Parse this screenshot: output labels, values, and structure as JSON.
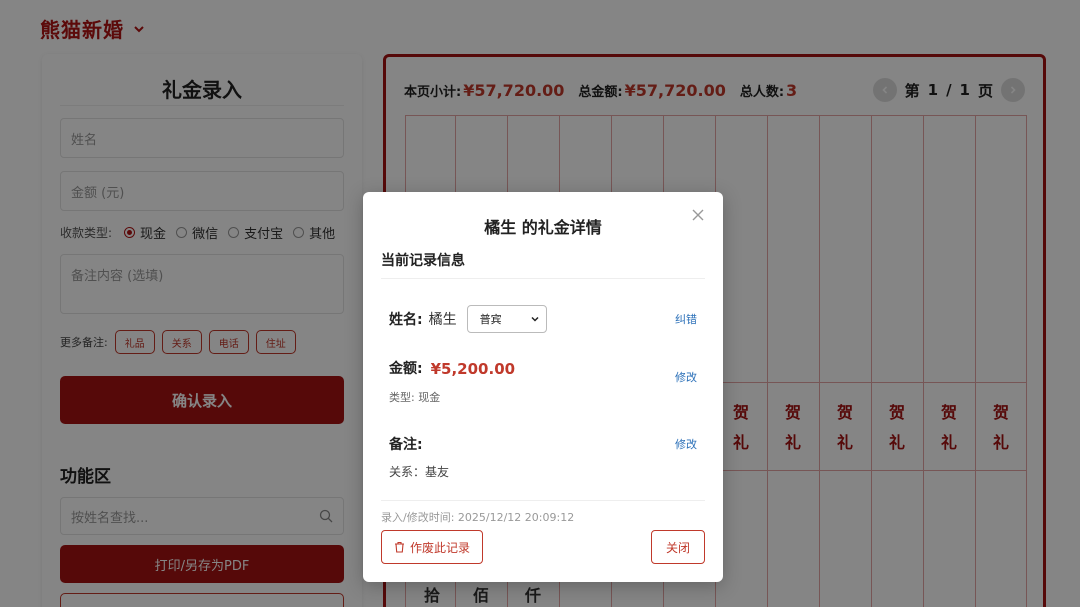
{
  "header": {
    "brand": "熊猫新婚"
  },
  "entry_form": {
    "title": "礼金录入",
    "name_placeholder": "姓名",
    "amount_placeholder": "金额 (元)",
    "payment_label": "收款类型:",
    "payment_options": [
      "现金",
      "微信",
      "支付宝",
      "其他"
    ],
    "payment_selected": "现金",
    "note_placeholder": "备注内容 (选填)",
    "more_notes_label": "更多备注:",
    "note_tags": [
      "礼品",
      "关系",
      "电话",
      "住址"
    ],
    "confirm_label": "确认录入"
  },
  "functions": {
    "title": "功能区",
    "search_placeholder": "按姓名查找...",
    "print_label": "打印/另存为PDF"
  },
  "ledger": {
    "page_subtotal_label": "本页小计:",
    "page_subtotal": "¥57,720.00",
    "total_label": "总金额:",
    "total": "¥57,720.00",
    "people_label": "总人数:",
    "people": "3",
    "page_prefix": "第",
    "page_current": "1",
    "page_sep": "/",
    "page_total": "1",
    "page_suffix": "页",
    "gift_char_top": "贺",
    "gift_char_bottom": "礼",
    "amount_chars": [
      "拾",
      "佰",
      "仟"
    ]
  },
  "modal": {
    "title": "橘生 的礼金详情",
    "section_title": "当前记录信息",
    "name_label": "姓名:",
    "name_value": "橘生",
    "guest_type_selected": "普宾",
    "correct_link": "纠错",
    "amount_label": "金额:",
    "amount_value": "¥5,200.00",
    "type_text": "类型: 现金",
    "edit_amount_link": "修改",
    "note_label": "备注:",
    "edit_note_link": "修改",
    "note_value": "关系：基友",
    "timestamp": "录入/修改时间: 2025/12/12 20:09:12",
    "void_label": "作废此记录",
    "close_label": "关闭"
  },
  "colors": {
    "brand_red": "#a51212",
    "accent_red": "#c0392b",
    "link_blue": "#2a6fb8"
  }
}
